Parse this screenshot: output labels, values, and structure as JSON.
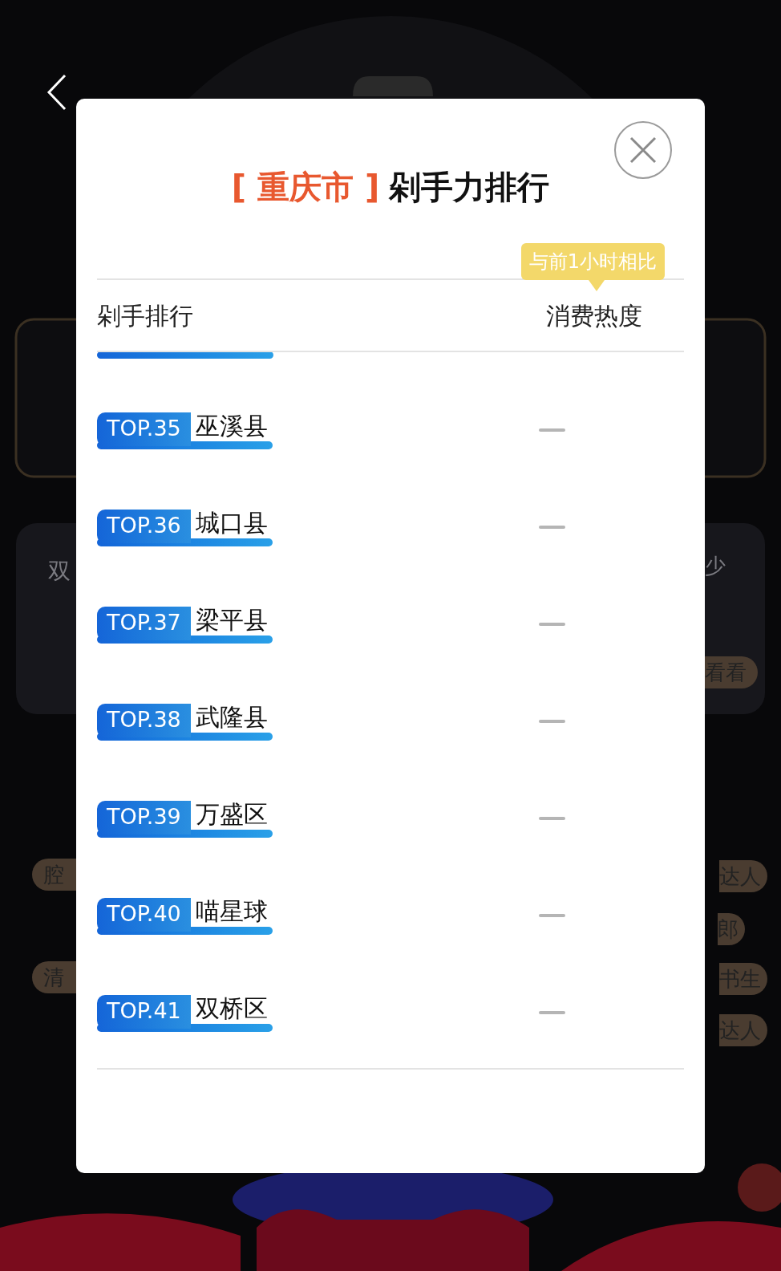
{
  "background": {
    "left_tags": [
      "双",
      "腔",
      "清"
    ],
    "right_tags": [
      "少",
      "看看",
      "达人",
      "郎",
      "书生",
      "达人"
    ]
  },
  "dialog": {
    "title_city": "[ 重庆市 ]",
    "title": "剁手力排行",
    "tooltip": "与前1小时相比",
    "columns": [
      "剁手排行",
      "消费热度"
    ],
    "rows": [
      {
        "kind": "clipped"
      },
      {
        "kind": "row",
        "rank": "TOP.35",
        "name": "巫溪县"
      },
      {
        "kind": "row",
        "rank": "TOP.36",
        "name": "城口县"
      },
      {
        "kind": "row",
        "rank": "TOP.37",
        "name": "梁平县"
      },
      {
        "kind": "row",
        "rank": "TOP.38",
        "name": "武隆县"
      },
      {
        "kind": "row",
        "rank": "TOP.39",
        "name": "万盛区"
      },
      {
        "kind": "row",
        "rank": "TOP.40",
        "name": "喵星球"
      },
      {
        "kind": "row",
        "rank": "TOP.41",
        "name": "双桥区"
      }
    ]
  }
}
